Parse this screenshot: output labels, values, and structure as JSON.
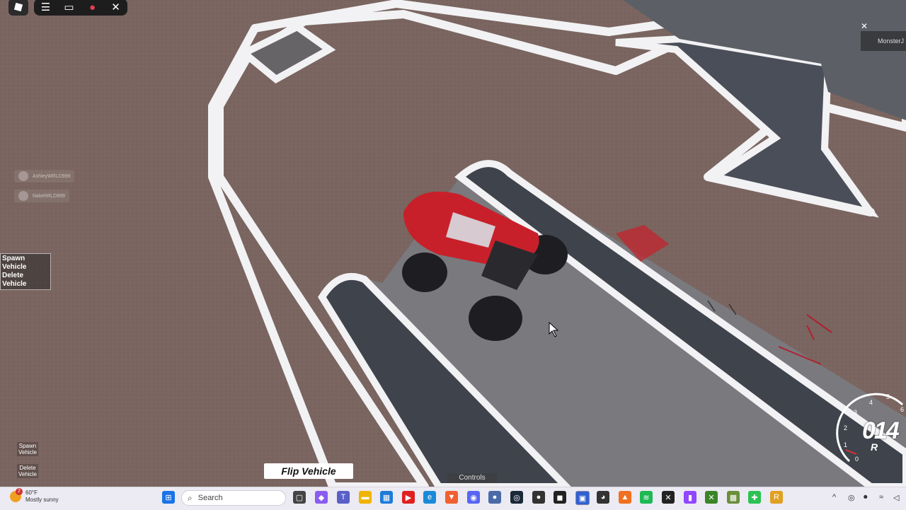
{
  "roblox": {
    "menu_icons": [
      "roblox-logo-icon",
      "hamburger-menu-icon",
      "chat-icon",
      "microphone-icon",
      "emote-icon"
    ]
  },
  "players": [
    {
      "name": "AshleyWRLD999"
    },
    {
      "name": "NakehRLD999"
    }
  ],
  "side_buttons": {
    "spawn": "Spawn Vehicle",
    "delete": "Delete Vehicle"
  },
  "small_buttons": {
    "spawn_line1": "Spawn",
    "spawn_line2": "Vehicle",
    "delete_line1": "Delete",
    "delete_line2": "Vehicle"
  },
  "flip_label": "Flip Vehicle",
  "controls_label": "Controls",
  "monster_label": "MonsterJ",
  "speedometer": {
    "speed": "014",
    "gear": "R",
    "ticks": [
      "0",
      "1",
      "2",
      "3",
      "4",
      "5",
      "6"
    ]
  },
  "taskbar": {
    "temperature": "60°F",
    "condition": "Mostly sunny",
    "weather_badge": "2",
    "search_placeholder": "Search",
    "tray_chevron": "^"
  },
  "colors": {
    "ground": "#7a6560",
    "track": "#6f6e72",
    "track_dark": "#3a3d45",
    "line": "#f2f2f4",
    "truck": "#c8202a"
  }
}
